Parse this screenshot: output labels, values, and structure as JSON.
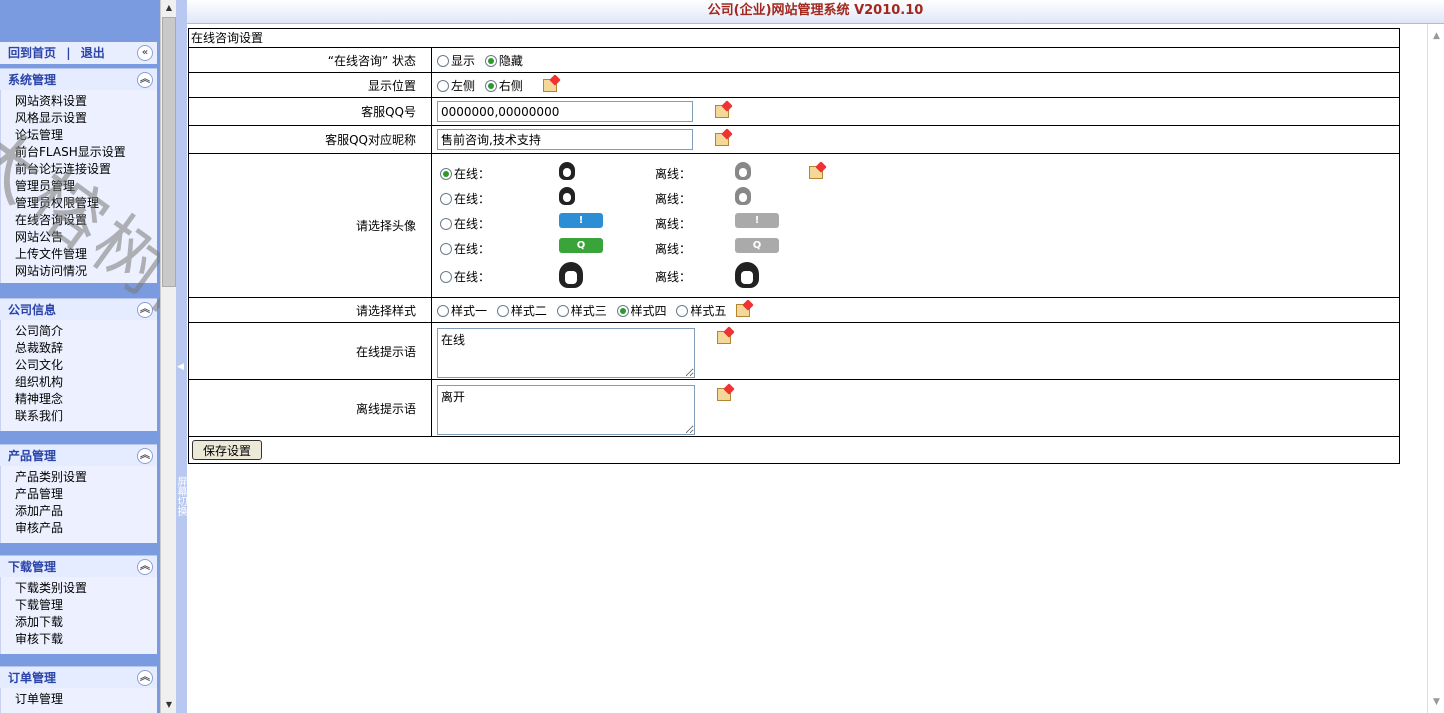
{
  "header": {
    "title": "公司(企业)网站管理系统 V2010.10"
  },
  "top_links": {
    "home": "回到首页",
    "sep": "|",
    "logout": "退出"
  },
  "menus": [
    {
      "title": "系统管理",
      "items": [
        "网站资料设置",
        "风格显示设置",
        "论坛管理",
        "前台FLASH显示设置",
        "前台论坛连接设置",
        "管理员管理",
        "管理员权限管理",
        "在线咨询设置",
        "网站公告",
        "上传文件管理",
        "网站访问情况"
      ]
    },
    {
      "title": "公司信息",
      "items": [
        "公司简介",
        "总裁致辞",
        "公司文化",
        "组织机构",
        "精神理念",
        "联系我们"
      ]
    },
    {
      "title": "产品管理",
      "items": [
        "产品类别设置",
        "产品管理",
        "添加产品",
        "审核产品"
      ]
    },
    {
      "title": "下载管理",
      "items": [
        "下载类别设置",
        "下载管理",
        "添加下载",
        "审核下载"
      ]
    },
    {
      "title": "订单管理",
      "items": [
        "订单管理"
      ]
    }
  ],
  "splitter": {
    "label": "屏幕切换"
  },
  "form": {
    "caption": "在线咨询设置",
    "status": {
      "label": "“在线咨询” 状态",
      "options": [
        "显示",
        "隐藏"
      ],
      "selected": "隐藏"
    },
    "position": {
      "label": "显示位置",
      "options": [
        "左侧",
        "右侧"
      ],
      "selected": "右侧"
    },
    "qq": {
      "label": "客服QQ号",
      "value": "0000000,00000000"
    },
    "nick": {
      "label": "客服QQ对应昵称",
      "value": "售前咨询,技术支持"
    },
    "avatar": {
      "label": "请选择头像",
      "online_label": "在线：",
      "offline_label": "离线：",
      "selected_index": 0
    },
    "style": {
      "label": "请选择样式",
      "options": [
        "样式一",
        "样式二",
        "样式三",
        "样式四",
        "样式五"
      ],
      "selected": "样式四"
    },
    "online_msg": {
      "label": "在线提示语",
      "value": "在线"
    },
    "offline_msg": {
      "label": "离线提示语",
      "value": "离开"
    },
    "save": "保存设置"
  },
  "watermark": "大榕树网络",
  "colors": {
    "sidebar": "#7a9be0",
    "title": "#a0281e",
    "menu_head": "#2a44a8"
  }
}
